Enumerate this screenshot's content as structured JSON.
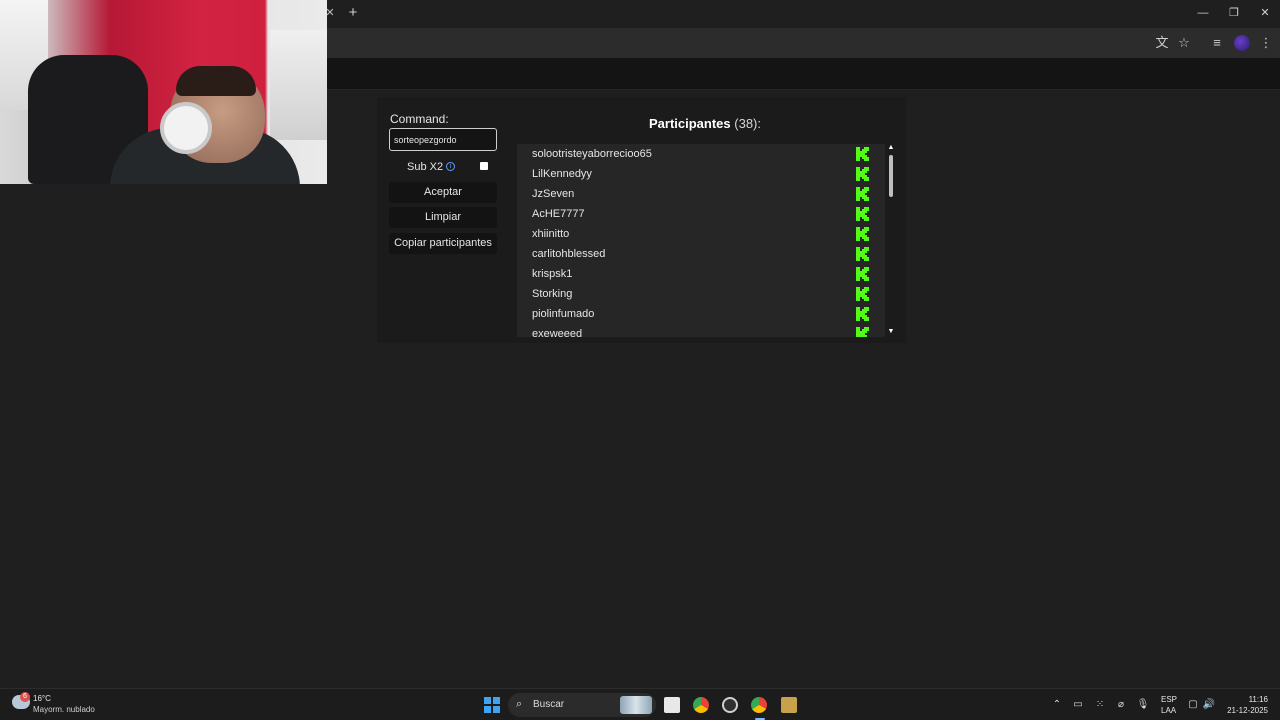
{
  "panel": {
    "command_label": "Command:",
    "command_value": "sorteopezgordo",
    "sub_label": "Sub X2",
    "info_icon": "i",
    "buttons": {
      "accept": "Aceptar",
      "clear": "Limpiar",
      "copy": "Copiar participantes"
    },
    "list_title": "Participantes",
    "list_count": "(38):",
    "participants": [
      "solootristeyaborrecioo65",
      "LilKennedyy",
      "JzSeven",
      "AcHE7777",
      "xhiinitto",
      "carlitohblessed",
      "krispsk1",
      "Storking",
      "piolinfumado",
      "exeweeed"
    ],
    "accent_color": "#53fc18",
    "participant_icon": "kick-logo-icon"
  },
  "taskbar": {
    "weather_temp": "16°C",
    "weather_desc": "Mayorm. nublado",
    "weather_badge": "6",
    "search_placeholder": "Buscar",
    "lang_top": "ESP",
    "lang_bottom": "LAA",
    "time": "11:16",
    "date": "21-12-2025"
  }
}
